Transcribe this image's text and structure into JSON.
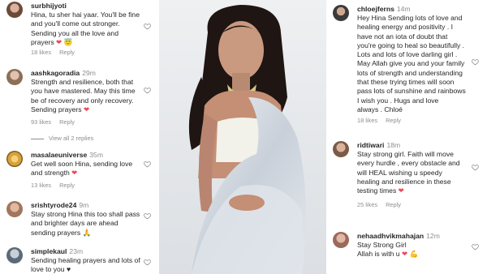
{
  "left_comments": [
    {
      "username": "surbhijyoti",
      "time": "",
      "text": "Hina, tu sher hai yaar. You'll be fine\nand you'll come out stronger.\nSending you all the love and\nprayers",
      "emoji": "❤",
      "extra_emoji": "😇",
      "likes": "18 likes",
      "reply": "Reply",
      "avatar_color": "#6b4a3a"
    },
    {
      "username": "aashkagoradia",
      "time": "29m",
      "text": "Strength and resilience, both that\nyou have mastered. May this time\nbe of recovery and only recovery.\nSending prayers",
      "emoji": "❤",
      "likes": "93 likes",
      "reply": "Reply",
      "avatar_color": "#8c6f58"
    },
    {
      "username": "masalaeuniverse",
      "time": "35m",
      "text": "Get well soon Hina, sending love\nand strength",
      "emoji": "❤",
      "likes": "13 likes",
      "reply": "Reply",
      "avatar_color": "#d8a23a"
    },
    {
      "username": "srishtyrode24",
      "time": "9m",
      "text": "Stay strong Hina this too shall pass\nand brighter days are ahead\nsending prayers",
      "emoji": "🙏",
      "extra_emoji": "❤",
      "likes": "",
      "reply": "",
      "avatar_color": "#a0765d"
    },
    {
      "username": "simplekaul",
      "time": "23m",
      "text": "Sending healing prayers and lots of\nlove to you",
      "emoji": "♥",
      "likes": "",
      "reply": "",
      "avatar_color": "#5a6a7a"
    }
  ],
  "view_replies": "View all 2 replies",
  "right_comments": [
    {
      "username": "chloejferns",
      "time": "14m",
      "text": "Hey Hina Sending lots of love and\nhealing energy and positivity . I\nhave not an iota of doubt that\nyou're going to heal so beautifully .\nLots and lots of love darling girl .\nMay Allah give you and your family\nlots of strength and understanding\nthat these trying times will soon\npass lots of sunshine and rainbows\nI wish you . Hugs and love\nalways . Chloé",
      "emoji": "❤",
      "likes": "18 likes",
      "reply": "Reply",
      "avatar_color": "#3a3a3a"
    },
    {
      "username": "ridtiwari",
      "time": "18m",
      "text": "Stay strong girl. Faith will move\nevery hurdle , every obstacle and\nwill HEAL  wishing u speedy\nhealing and resilience in these\ntesting times",
      "emoji": "❤",
      "likes": "25 likes",
      "reply": "Reply",
      "avatar_color": "#7a5a48"
    },
    {
      "username": "nehaadhvikmahajan",
      "time": "12m",
      "text": "Stay Strong Girl\nAllah is with u",
      "emoji": "💪",
      "extra_emoji": "❤",
      "likes": "",
      "reply": "",
      "avatar_color": "#9a6a5a"
    }
  ],
  "colors": {
    "heart_red": "#ed4956",
    "meta_gray": "#8e8e8e",
    "text": "#262626",
    "saree": "#d9dde3",
    "hair": "#1f1512",
    "skin": "#c99a80"
  },
  "icons": {
    "like": "heart-outline-icon"
  }
}
